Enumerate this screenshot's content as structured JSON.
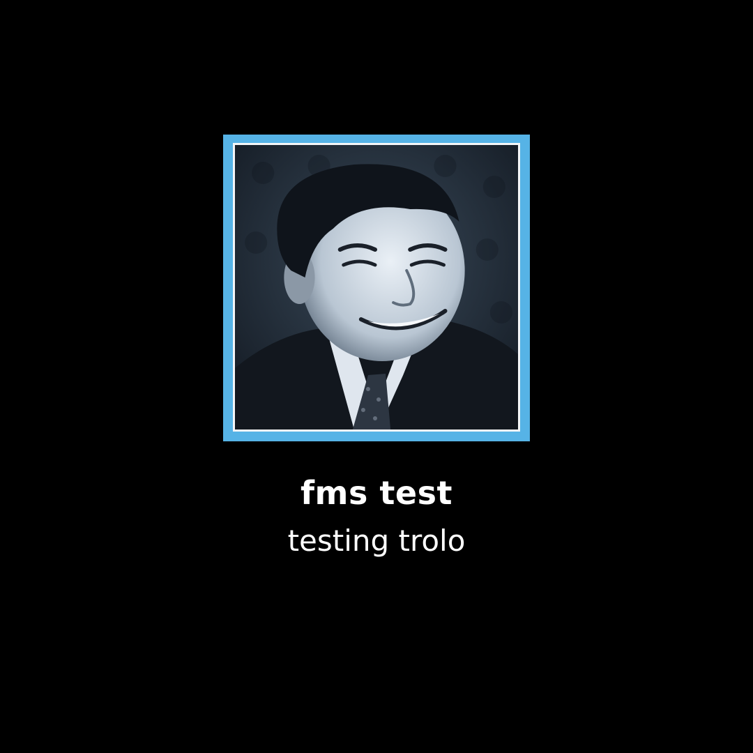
{
  "colors": {
    "background": "#000000",
    "frame_border": "#56b3e6",
    "text": "#ffffff"
  },
  "media": {
    "image_icon": "portrait-photo",
    "title": "fms test",
    "subtitle": "testing trolo"
  }
}
